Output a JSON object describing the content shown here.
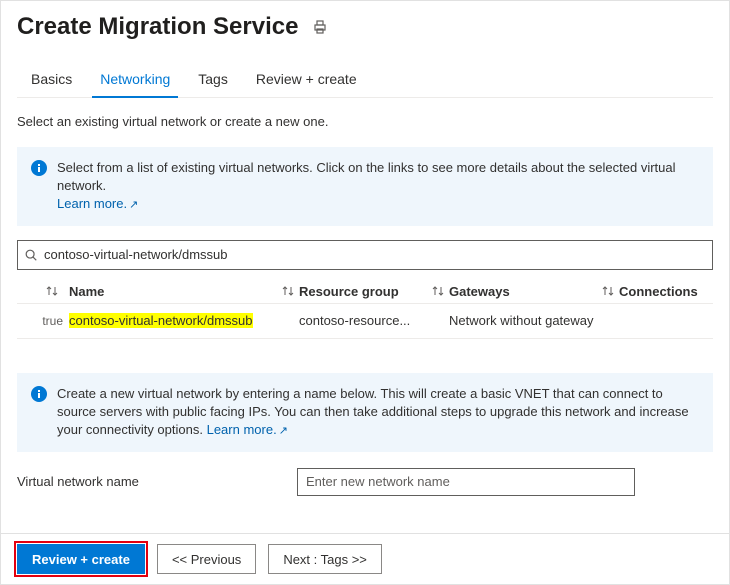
{
  "header": {
    "title": "Create Migration Service"
  },
  "tabs": {
    "items": [
      {
        "label": "Basics"
      },
      {
        "label": "Networking"
      },
      {
        "label": "Tags"
      },
      {
        "label": "Review + create"
      }
    ],
    "selected_index": 1
  },
  "intro_text": "Select an existing virtual network or create a new one.",
  "info1": {
    "text": "Select from a list of existing virtual networks. Click on the links to see more details about the selected virtual network.",
    "learn_more": "Learn more."
  },
  "search": {
    "value": "contoso-virtual-network/dmssub"
  },
  "grid": {
    "columns": {
      "name": "Name",
      "resource_group": "Resource group",
      "gateways": "Gateways",
      "connections": "Connections"
    },
    "row": {
      "checked_text": "true",
      "name": "contoso-virtual-network/dmssub",
      "resource_group": "contoso-resource...",
      "gateways": "Network without gateway"
    }
  },
  "info2": {
    "text": "Create a new virtual network by entering a name below. This will create a basic VNET that can connect to source servers with public facing IPs. You can then take additional steps to upgrade this network and increase your connectivity options.",
    "learn_more": "Learn more."
  },
  "vnet_form": {
    "label": "Virtual network name",
    "placeholder": "Enter new network name",
    "value": ""
  },
  "footer": {
    "primary": "Review + create",
    "previous": "<< Previous",
    "next": "Next : Tags >>"
  }
}
